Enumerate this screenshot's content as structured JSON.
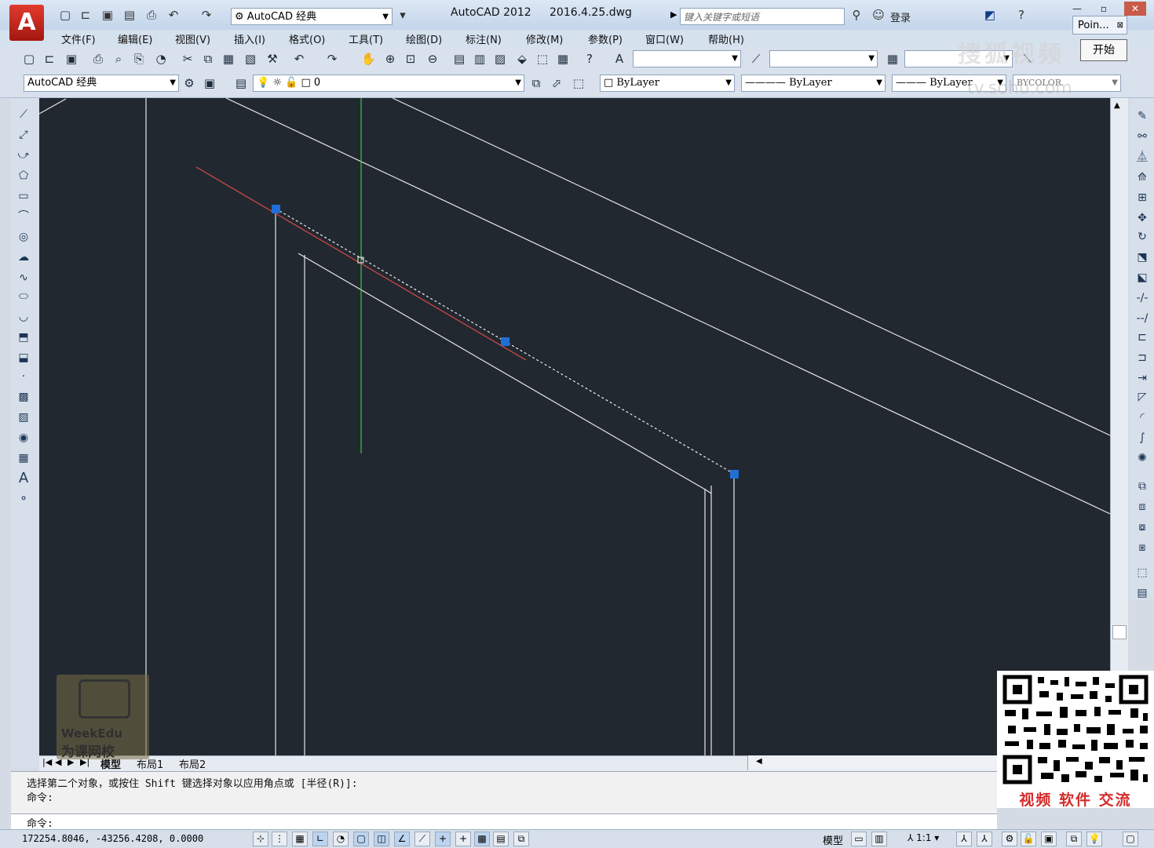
{
  "titlebar": {
    "workspace": "AutoCAD 经典",
    "app_title": "AutoCAD 2012",
    "file_name": "2016.4.25.dwg",
    "search_placeholder": "键入关键字或短语",
    "login": "登录",
    "point_tab": "Poin...",
    "start_button": "开始"
  },
  "menu": [
    "文件(F)",
    "编辑(E)",
    "视图(V)",
    "插入(I)",
    "格式(O)",
    "工具(T)",
    "绘图(D)",
    "标注(N)",
    "修改(M)",
    "参数(P)",
    "窗口(W)",
    "帮助(H)"
  ],
  "properties_bar": {
    "workspace": "AutoCAD 经典",
    "layer": "0",
    "color": "ByLayer",
    "linetype": "ByLayer",
    "lineweight": "ByLayer",
    "plotstyle": "BYCOLOR"
  },
  "tabs": [
    "模型",
    "布局1",
    "布局2"
  ],
  "command": {
    "history_line": "选择第二个对象，或按住 Shift 键选择对象以应用角点或 [半径(R)]:",
    "history_prompt": "命令:",
    "current_prompt": "命令:"
  },
  "status": {
    "coordinates": "172254.8046,  -43256.4208,  0.0000",
    "model_label": "模型",
    "scale": "1:1"
  },
  "watermarks": {
    "site_mark": "搜狐视频",
    "site_url": "tv.sohu.com",
    "weekedu": "WeekEdu",
    "weekedu_cn": "为课网校",
    "qr_caption": "视频 软件 交流"
  },
  "colors": {
    "canvas_bg": "#212830",
    "line": "#e8e8e8",
    "selected_line": "#d84a4a",
    "grip": "#1f6fd6",
    "ucs_y": "#3ec63e"
  },
  "icons": {
    "draw_tools": [
      "line-icon",
      "construction-line-icon",
      "polyline-icon",
      "polygon-icon",
      "rectangle-icon",
      "arc-icon",
      "circle-icon",
      "revcloud-icon",
      "spline-icon",
      "ellipse-icon",
      "ellipse-arc-icon",
      "insert-block-icon",
      "make-block-icon",
      "point-icon",
      "hatch-icon",
      "gradient-icon",
      "region-icon",
      "table-icon",
      "mtext-icon",
      "add-selected-icon"
    ],
    "modify_tools": [
      "erase-icon",
      "copy-icon",
      "mirror-icon",
      "offset-icon",
      "array-icon",
      "move-icon",
      "rotate-icon",
      "scale-icon",
      "stretch-icon",
      "trim-icon",
      "extend-icon",
      "break-at-point-icon",
      "break-icon",
      "join-icon",
      "chamfer-icon",
      "fillet-icon",
      "blend-icon",
      "explode-icon"
    ]
  }
}
